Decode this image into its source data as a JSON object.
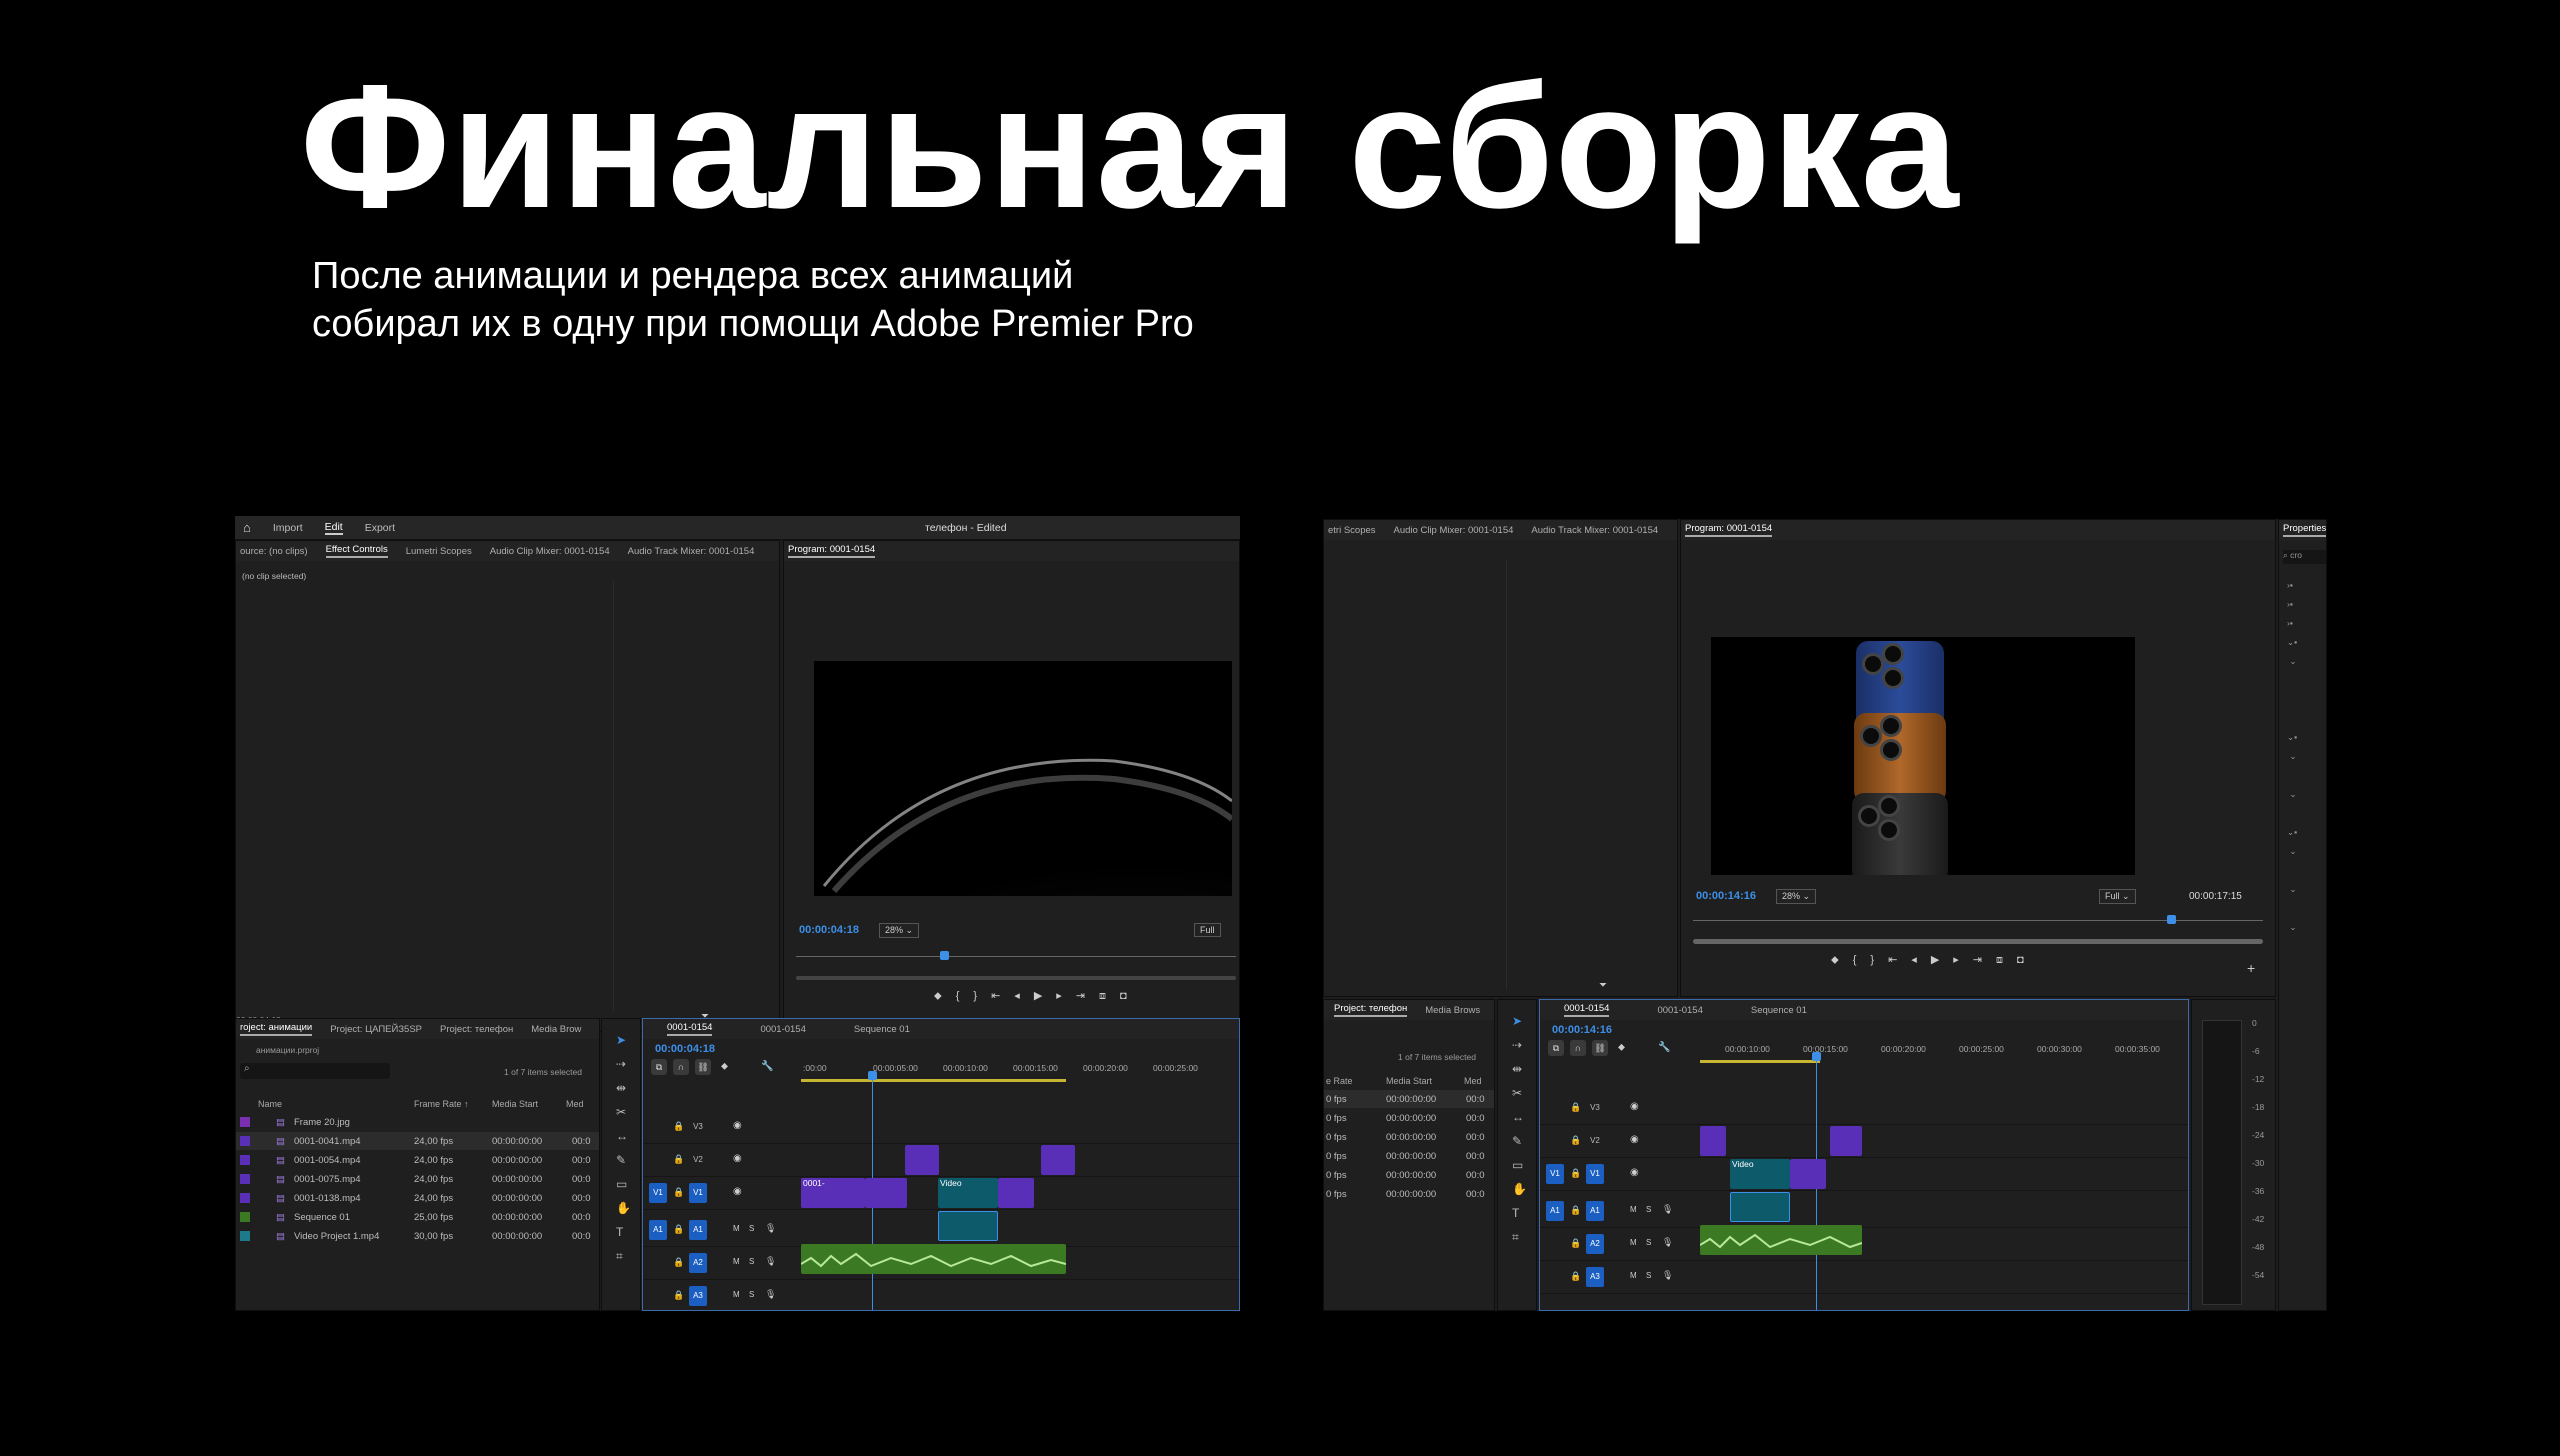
{
  "heading": {
    "title": "Финальная сборка",
    "subtitle_line1": "После анимации и рендера всех анимаций",
    "subtitle_line2": "собирал их в одну при помощи Adobe Premier Pro"
  },
  "left": {
    "menu": {
      "import": "Import",
      "edit": "Edit",
      "export": "Export",
      "doc_title": "телефон - Edited"
    },
    "source_tabs": [
      "ource: (no clips)",
      "Effect Controls",
      "Lumetri Scopes",
      "Audio Clip Mixer: 0001-0154",
      "Audio Track Mixer: 0001-0154"
    ],
    "no_clip": "(no clip selected)",
    "source_time": "00:00:04:18",
    "program_tab": "Program: 0001-0154",
    "program_time": "00:00:04:18",
    "zoom": "28%",
    "quality": "Full",
    "project_tabs": [
      "roject: анимации",
      "Project: ЦАПЕЙЗ5SP",
      "Project: телефон",
      "Media Brow"
    ],
    "project_file": "анимации.prproj",
    "items_selected": "1 of 7 items selected",
    "columns": [
      "Name",
      "Frame Rate ↑",
      "Media Start",
      "Med"
    ],
    "files": [
      {
        "name": "Frame 20.jpg",
        "rate": "",
        "start": "",
        "med": "",
        "color": "#7a2fb0"
      },
      {
        "name": "0001-0041.mp4",
        "rate": "24,00 fps",
        "start": "00:00:00:00",
        "med": "00:0",
        "color": "#5a2fb8"
      },
      {
        "name": "0001-0054.mp4",
        "rate": "24,00 fps",
        "start": "00:00:00:00",
        "med": "00:0",
        "color": "#5a2fb8"
      },
      {
        "name": "0001-0075.mp4",
        "rate": "24,00 fps",
        "start": "00:00:00:00",
        "med": "00:0",
        "color": "#5a2fb8"
      },
      {
        "name": "0001-0138.mp4",
        "rate": "24,00 fps",
        "start": "00:00:00:00",
        "med": "00:0",
        "color": "#5a2fb8"
      },
      {
        "name": "Sequence 01",
        "rate": "25,00 fps",
        "start": "00:00:00:00",
        "med": "00:0",
        "color": "#3b7a22"
      },
      {
        "name": "Video Project 1.mp4",
        "rate": "30,00 fps",
        "start": "00:00:00:00",
        "med": "00:0",
        "color": "#1d7a8a"
      }
    ],
    "timeline_tabs": [
      "0001-0154",
      "0001-0154",
      "Sequence 01"
    ],
    "timeline_time": "00:00:04:18",
    "ruler": [
      ":00:00",
      "00:00:05:00",
      "00:00:10:00",
      "00:00:15:00",
      "00:00:20:00",
      "00:00:25:00"
    ],
    "tracks": [
      "V3",
      "V2",
      "V1",
      "A1",
      "A2",
      "A3"
    ],
    "clip_labels": [
      "0001-",
      "Video"
    ]
  },
  "right": {
    "top_tabs": [
      "etri Scopes",
      "Audio Clip Mixer: 0001-0154",
      "Audio Track Mixer: 0001-0154"
    ],
    "program_tab": "Program: 0001-0154",
    "properties_tab": "Properties",
    "time_left": "00:00:14:16",
    "time_right": "00:00:17:15",
    "zoom": "28%",
    "quality": "Full",
    "project_tabs": [
      "Project: телефон",
      "Media Brows"
    ],
    "items_selected": "1 of 7 items selected",
    "columns": [
      "e Rate",
      "Media Start",
      "Med"
    ],
    "rows": [
      [
        "0 fps",
        "00:00:00:00",
        "00:0"
      ],
      [
        "0 fps",
        "00:00:00:00",
        "00:0"
      ],
      [
        "0 fps",
        "00:00:00:00",
        "00:0"
      ],
      [
        "0 fps",
        "00:00:00:00",
        "00:0"
      ],
      [
        "0 fps",
        "00:00:00:00",
        "00:0"
      ],
      [
        "0 fps",
        "00:00:00:00",
        "00:0"
      ]
    ],
    "timeline_tabs": [
      "0001-0154",
      "0001-0154",
      "Sequence 01"
    ],
    "timeline_time": "00:00:14:16",
    "ruler": [
      "00:00:10:00",
      "00:00:15:00",
      "00:00:20:00",
      "00:00:25:00",
      "00:00:30:00",
      "00:00:35:00"
    ],
    "tracks": [
      "V3",
      "V2",
      "V1",
      "A1",
      "A2",
      "A3"
    ],
    "clip_label": "Video",
    "meter": [
      "0",
      "-6",
      "-12",
      "-18",
      "-24",
      "-30",
      "-36",
      "-42",
      "-48",
      "-54"
    ],
    "search_placeholder": "cro"
  },
  "colors": {
    "accent": "#3d8fe8",
    "video_clip": "#5a2fb8",
    "audio_clip": "#3b7a22",
    "track_label": "#1b5fc2"
  }
}
